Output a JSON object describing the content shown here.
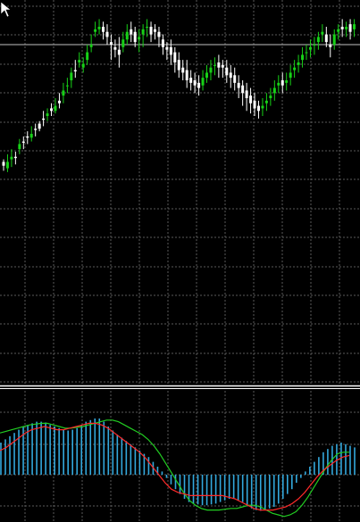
{
  "theme": {
    "background": "#000000",
    "grid_color": "#5a5a5a",
    "bull_color": "#17d117",
    "bear_color": "#ffffff",
    "level_line_color": "#c0c0c0",
    "histogram_color": "#33a8dc",
    "signal_fast_color": "#22cc22",
    "signal_slow_color": "#ff2a2a",
    "separator_color": "#ffffff"
  },
  "chart_data": [
    {
      "type": "candlestick",
      "title": "",
      "grid": true,
      "series": [
        {
          "name": "",
          "values": [
            [
              60,
              57,
              62,
              53
            ],
            [
              55,
              60,
              66,
              52
            ],
            [
              62,
              64,
              70,
              56
            ],
            [
              64,
              63,
              68,
              58
            ],
            [
              70,
              74,
              78,
              66
            ],
            [
              76,
              75,
              80,
              70
            ],
            [
              80,
              79,
              84,
              74
            ],
            [
              79,
              82,
              88,
              76
            ],
            [
              86,
              85,
              90,
              80
            ],
            [
              90,
              86,
              92,
              84
            ],
            [
              94,
              93,
              100,
              88
            ],
            [
              96,
              98,
              102,
              92
            ],
            [
              102,
              100,
              106,
              96
            ],
            [
              100,
              104,
              110,
              98
            ],
            [
              108,
              106,
              114,
              102
            ],
            [
              112,
              116,
              122,
              106
            ],
            [
              120,
              120,
              126,
              114
            ],
            [
              124,
              130,
              134,
              118
            ],
            [
              132,
              131,
              140,
              126
            ],
            [
              138,
              140,
              146,
              134
            ],
            [
              134,
              137,
              142,
              130
            ],
            [
              140,
              146,
              152,
              136
            ],
            [
              150,
              152,
              160,
              146
            ],
            [
              162,
              164,
              170,
              158
            ],
            [
              164,
              166,
              172,
              160
            ],
            [
              166,
              162,
              170,
              156
            ],
            [
              162,
              158,
              168,
              152
            ],
            [
              154,
              152,
              160,
              140
            ],
            [
              150,
              148,
              156,
              142
            ],
            [
              148,
              144,
              158,
              134
            ],
            [
              150,
              156,
              162,
              146
            ],
            [
              156,
              162,
              168,
              152
            ],
            [
              164,
              160,
              170,
              154
            ],
            [
              162,
              154,
              166,
              150
            ],
            [
              156,
              158,
              164,
              146
            ],
            [
              160,
              164,
              168,
              150
            ],
            [
              166,
              166,
              172,
              158
            ],
            [
              166,
              160,
              170,
              154
            ],
            [
              164,
              162,
              168,
              156
            ],
            [
              162,
              158,
              166,
              150
            ],
            [
              156,
              150,
              160,
              144
            ],
            [
              150,
              148,
              154,
              140
            ],
            [
              150,
              144,
              156,
              136
            ],
            [
              146,
              138,
              150,
              130
            ],
            [
              140,
              132,
              146,
              126
            ],
            [
              134,
              130,
              140,
              124
            ],
            [
              132,
              124,
              140,
              118
            ],
            [
              126,
              122,
              132,
              116
            ],
            [
              124,
              120,
              130,
              114
            ],
            [
              122,
              118,
              128,
              112
            ],
            [
              120,
              126,
              132,
              116
            ],
            [
              126,
              130,
              136,
              122
            ],
            [
              130,
              134,
              140,
              124
            ],
            [
              136,
              136,
              142,
              128
            ],
            [
              138,
              134,
              144,
              126
            ],
            [
              136,
              134,
              140,
              126
            ],
            [
              134,
              128,
              140,
              122
            ],
            [
              130,
              126,
              136,
              118
            ],
            [
              128,
              122,
              134,
              116
            ],
            [
              122,
              118,
              128,
              110
            ],
            [
              120,
              114,
              124,
              104
            ],
            [
              116,
              110,
              122,
              100
            ],
            [
              112,
              106,
              118,
              98
            ],
            [
              108,
              102,
              114,
              96
            ],
            [
              104,
              100,
              108,
              94
            ],
            [
              102,
              104,
              110,
              96
            ],
            [
              106,
              108,
              114,
              100
            ],
            [
              110,
              112,
              118,
              104
            ],
            [
              114,
              118,
              124,
              108
            ],
            [
              120,
              122,
              128,
              114
            ],
            [
              124,
              120,
              130,
              114
            ],
            [
              122,
              124,
              130,
              116
            ],
            [
              126,
              130,
              136,
              120
            ],
            [
              132,
              134,
              140,
              126
            ],
            [
              136,
              138,
              144,
              130
            ],
            [
              140,
              144,
              150,
              134
            ],
            [
              146,
              146,
              152,
              140
            ],
            [
              148,
              150,
              156,
              142
            ],
            [
              152,
              152,
              158,
              144
            ],
            [
              154,
              158,
              162,
              148
            ],
            [
              160,
              162,
              168,
              154
            ],
            [
              160,
              154,
              166,
              150
            ],
            [
              152,
              150,
              160,
              142
            ],
            [
              152,
              160,
              164,
              148
            ],
            [
              162,
              164,
              168,
              156
            ],
            [
              166,
              164,
              172,
              158
            ],
            [
              164,
              166,
              170,
              158
            ],
            [
              168,
              162,
              172,
              156
            ],
            [
              164,
              168,
              172,
              158
            ]
          ]
        }
      ]
    },
    {
      "type": "bar",
      "title": "",
      "grid": true,
      "series": [
        {
          "name": "",
          "values": [
            0.4,
            0.44,
            0.48,
            0.52,
            0.56,
            0.6,
            0.62,
            0.64,
            0.66,
            0.66,
            0.65,
            0.62,
            0.6,
            0.58,
            0.56,
            0.55,
            0.56,
            0.58,
            0.62,
            0.66,
            0.68,
            0.7,
            0.7,
            0.66,
            0.6,
            0.55,
            0.5,
            0.46,
            0.42,
            0.38,
            0.34,
            0.3,
            0.26,
            0.22,
            0.16,
            0.1,
            0.04,
            -0.04,
            -0.12,
            -0.18,
            -0.24,
            -0.3,
            -0.34,
            -0.36,
            -0.37,
            -0.38,
            -0.38,
            -0.37,
            -0.36,
            -0.34,
            -0.32,
            -0.3,
            -0.3,
            -0.32,
            -0.34,
            -0.38,
            -0.42,
            -0.44,
            -0.45,
            -0.44,
            -0.42,
            -0.4,
            -0.36,
            -0.3,
            -0.24,
            -0.18,
            -0.1,
            -0.04,
            0.04,
            0.1,
            0.16,
            0.22,
            0.28,
            0.32,
            0.36,
            0.38,
            0.4,
            0.38,
            0.36,
            0.34
          ]
        },
        {
          "name": "",
          "values": [
            0.52,
            0.54,
            0.56,
            0.58,
            0.6,
            0.62,
            0.63,
            0.64,
            0.64,
            0.62,
            0.6,
            0.58,
            0.58,
            0.59,
            0.6,
            0.62,
            0.64,
            0.66,
            0.68,
            0.68,
            0.66,
            0.62,
            0.58,
            0.54,
            0.5,
            0.44,
            0.36,
            0.26,
            0.14,
            0.02,
            -0.1,
            -0.22,
            -0.32,
            -0.38,
            -0.42,
            -0.44,
            -0.44,
            -0.44,
            -0.43,
            -0.42,
            -0.42,
            -0.4,
            -0.38,
            -0.38,
            -0.4,
            -0.44,
            -0.48,
            -0.5,
            -0.52,
            -0.5,
            -0.46,
            -0.38,
            -0.28,
            -0.16,
            -0.04,
            0.08,
            0.18,
            0.26,
            0.28,
            0.28
          ]
        },
        {
          "name": "",
          "values": [
            0.3,
            0.34,
            0.4,
            0.46,
            0.52,
            0.56,
            0.58,
            0.6,
            0.58,
            0.56,
            0.56,
            0.58,
            0.6,
            0.62,
            0.64,
            0.64,
            0.62,
            0.58,
            0.52,
            0.46,
            0.4,
            0.34,
            0.28,
            0.2,
            0.1,
            0.0,
            -0.1,
            -0.18,
            -0.22,
            -0.24,
            -0.26,
            -0.26,
            -0.26,
            -0.26,
            -0.26,
            -0.26,
            -0.28,
            -0.3,
            -0.34,
            -0.38,
            -0.42,
            -0.44,
            -0.44,
            -0.44,
            -0.42,
            -0.4,
            -0.36,
            -0.3,
            -0.22,
            -0.12,
            -0.02,
            0.06,
            0.12,
            0.18,
            0.22,
            0.24
          ]
        }
      ]
    }
  ],
  "level_line": 152
}
